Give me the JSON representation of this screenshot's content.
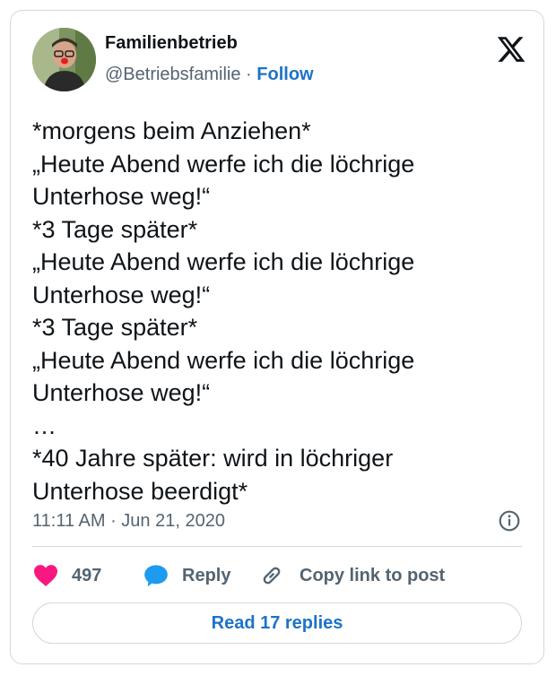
{
  "author": {
    "name": "Familienbetrieb",
    "handle": "@Betriebsfamilie",
    "separator": "·",
    "follow_label": "Follow"
  },
  "platform_icon": "x-logo-icon",
  "tweet": {
    "lines": [
      "*morgens beim Anziehen*",
      "„Heute Abend werfe ich die löchrige",
      "Unterhose weg!“",
      "*3 Tage später*",
      "„Heute Abend werfe ich die löchrige",
      "Unterhose weg!“",
      "*3 Tage später*",
      "„Heute Abend werfe ich die löchrige",
      "Unterhose weg!“",
      "…",
      "*40 Jahre später: wird in löchriger",
      "Unterhose beerdigt*"
    ],
    "timestamp": "11:11 AM · Jun 21, 2020"
  },
  "actions": {
    "likes": "497",
    "reply_label": "Reply",
    "copy_label": "Copy link to post"
  },
  "read_replies_label": "Read 17 replies",
  "colors": {
    "link": "#1d73c8",
    "heart": "#f91880",
    "reply_bubble": "#1d9bf0",
    "muted": "#536471",
    "border": "#cfd9de"
  }
}
